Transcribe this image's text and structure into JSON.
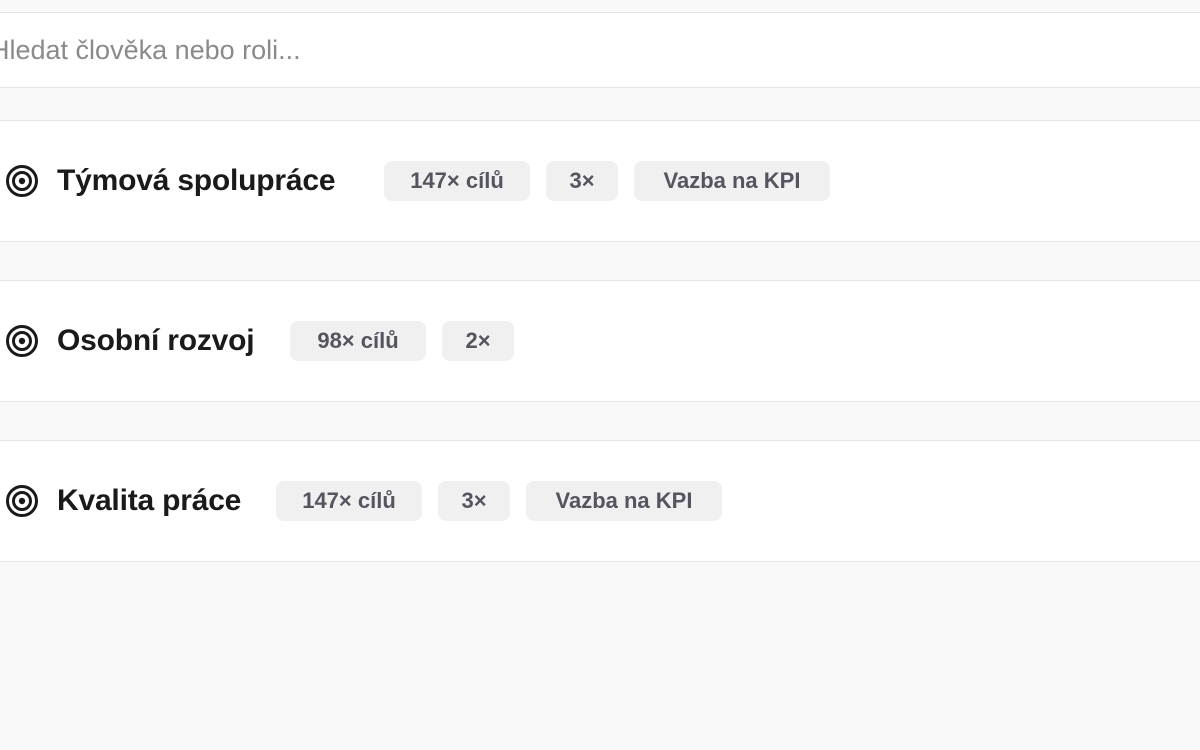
{
  "search": {
    "placeholder": "Hledat člověka nebo roli..."
  },
  "goals": [
    {
      "title": "Týmová spolupráce",
      "goal_count": "147× cílů",
      "multiplier": "3×",
      "kpi_link": "Vazba na KPI"
    },
    {
      "title": "Osobní rozvoj",
      "goal_count": "98× cílů",
      "multiplier": "2×"
    },
    {
      "title": "Kvalita práce",
      "goal_count": "147× cílů",
      "multiplier": "3×",
      "kpi_link": "Vazba na KPI"
    }
  ],
  "icons": {
    "goal": "target-icon"
  },
  "colors": {
    "background": "#f9f9f9",
    "card": "#ffffff",
    "badge_bg": "#f0f0f1",
    "badge_text": "#555560",
    "title_text": "#1a1a1a",
    "placeholder": "#8a8a8a"
  }
}
